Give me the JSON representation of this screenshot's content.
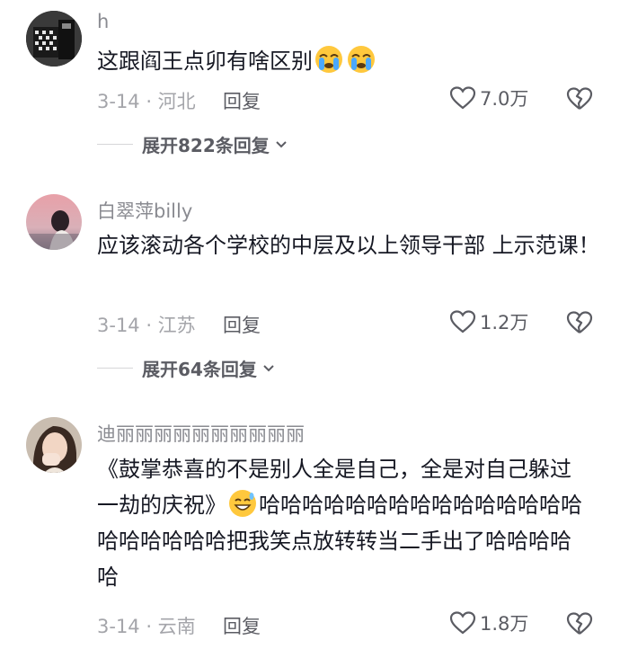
{
  "comments": [
    {
      "username": "h",
      "text": "这跟阎王点卯有啥区别",
      "emojis": [
        "crying-face",
        "crying-face"
      ],
      "date_location": "3-14 · 河北",
      "reply_label": "回复",
      "likes": "7.0万",
      "expand_label": "展开822条回复"
    },
    {
      "username": "白翠萍billy",
      "text": "应该滚动各个学校的中层及以上领导干部 上示范课！",
      "date_location": "3-14 · 江苏",
      "reply_label": "回复",
      "likes": "1.2万",
      "expand_label": "展开64条回复"
    },
    {
      "username": "迪丽丽丽丽丽丽丽丽丽丽",
      "text_before_emoji": "《鼓掌恭喜的不是别人全是自己，全是对自己躲过一劫的庆祝》",
      "emojis": [
        "grinning-sweat-face"
      ],
      "text_after_emoji": "哈哈哈哈哈哈哈哈哈哈哈哈哈哈哈哈哈哈哈哈哈把我笑点放转转当二手出了哈哈哈哈哈",
      "date_location": "3-14 · 云南",
      "reply_label": "回复",
      "likes": "1.8万"
    }
  ]
}
